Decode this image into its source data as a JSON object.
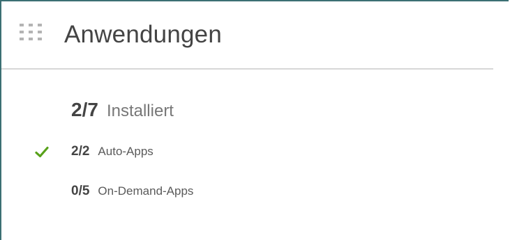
{
  "header": {
    "title": "Anwendungen",
    "icon": "apps-grid-icon"
  },
  "stats": {
    "installed": {
      "count": "2/7",
      "label": "Installiert"
    },
    "auto_apps": {
      "count": "2/2",
      "label": "Auto-Apps",
      "status_icon": "check-icon",
      "status_color": "#58a11a"
    },
    "on_demand_apps": {
      "count": "0/5",
      "label": "On-Demand-Apps"
    }
  },
  "colors": {
    "frame_border": "#3b6f73",
    "divider": "#d7d7d7",
    "title_text": "#444444",
    "muted_text": "#777777",
    "grid_icon": "#b4b4b4"
  }
}
